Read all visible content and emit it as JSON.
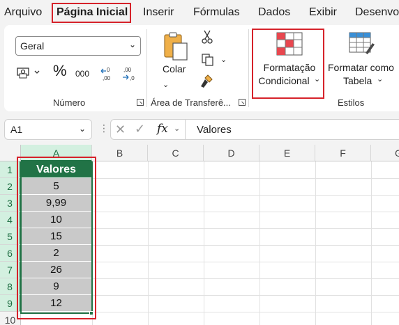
{
  "tabs": [
    "Arquivo",
    "Página Inicial",
    "Inserir",
    "Fórmulas",
    "Dados",
    "Exibir",
    "Desenvo"
  ],
  "active_tab": "Página Inicial",
  "ribbon": {
    "number_format_value": "Geral",
    "number_format_buttons": [
      "currency-format-icon",
      "%",
      "000",
      "decrease-decimal-icon",
      "increase-decimal-icon"
    ],
    "group_numero": "Número",
    "paste_label": "Colar",
    "group_clipboard": "Área de Transferê...",
    "cond_format_line1": "Formatação",
    "cond_format_line2": "Condicional",
    "format_table_line1": "Formatar como",
    "format_table_line2": "Tabela",
    "group_styles": "Estilos"
  },
  "formula_bar": {
    "name_box": "A1",
    "fx": "fx",
    "content": "Valores"
  },
  "sheet": {
    "columns": [
      "A",
      "B",
      "C",
      "D",
      "E",
      "F",
      "G"
    ],
    "rows": [
      "1",
      "2",
      "3",
      "4",
      "5",
      "6",
      "7",
      "8",
      "9",
      "10"
    ],
    "column_a": [
      "Valores",
      "5",
      "9,99",
      "10",
      "15",
      "2",
      "26",
      "9",
      "12"
    ]
  },
  "colors": {
    "accent": "#217346",
    "highlight": "#d6222a"
  }
}
